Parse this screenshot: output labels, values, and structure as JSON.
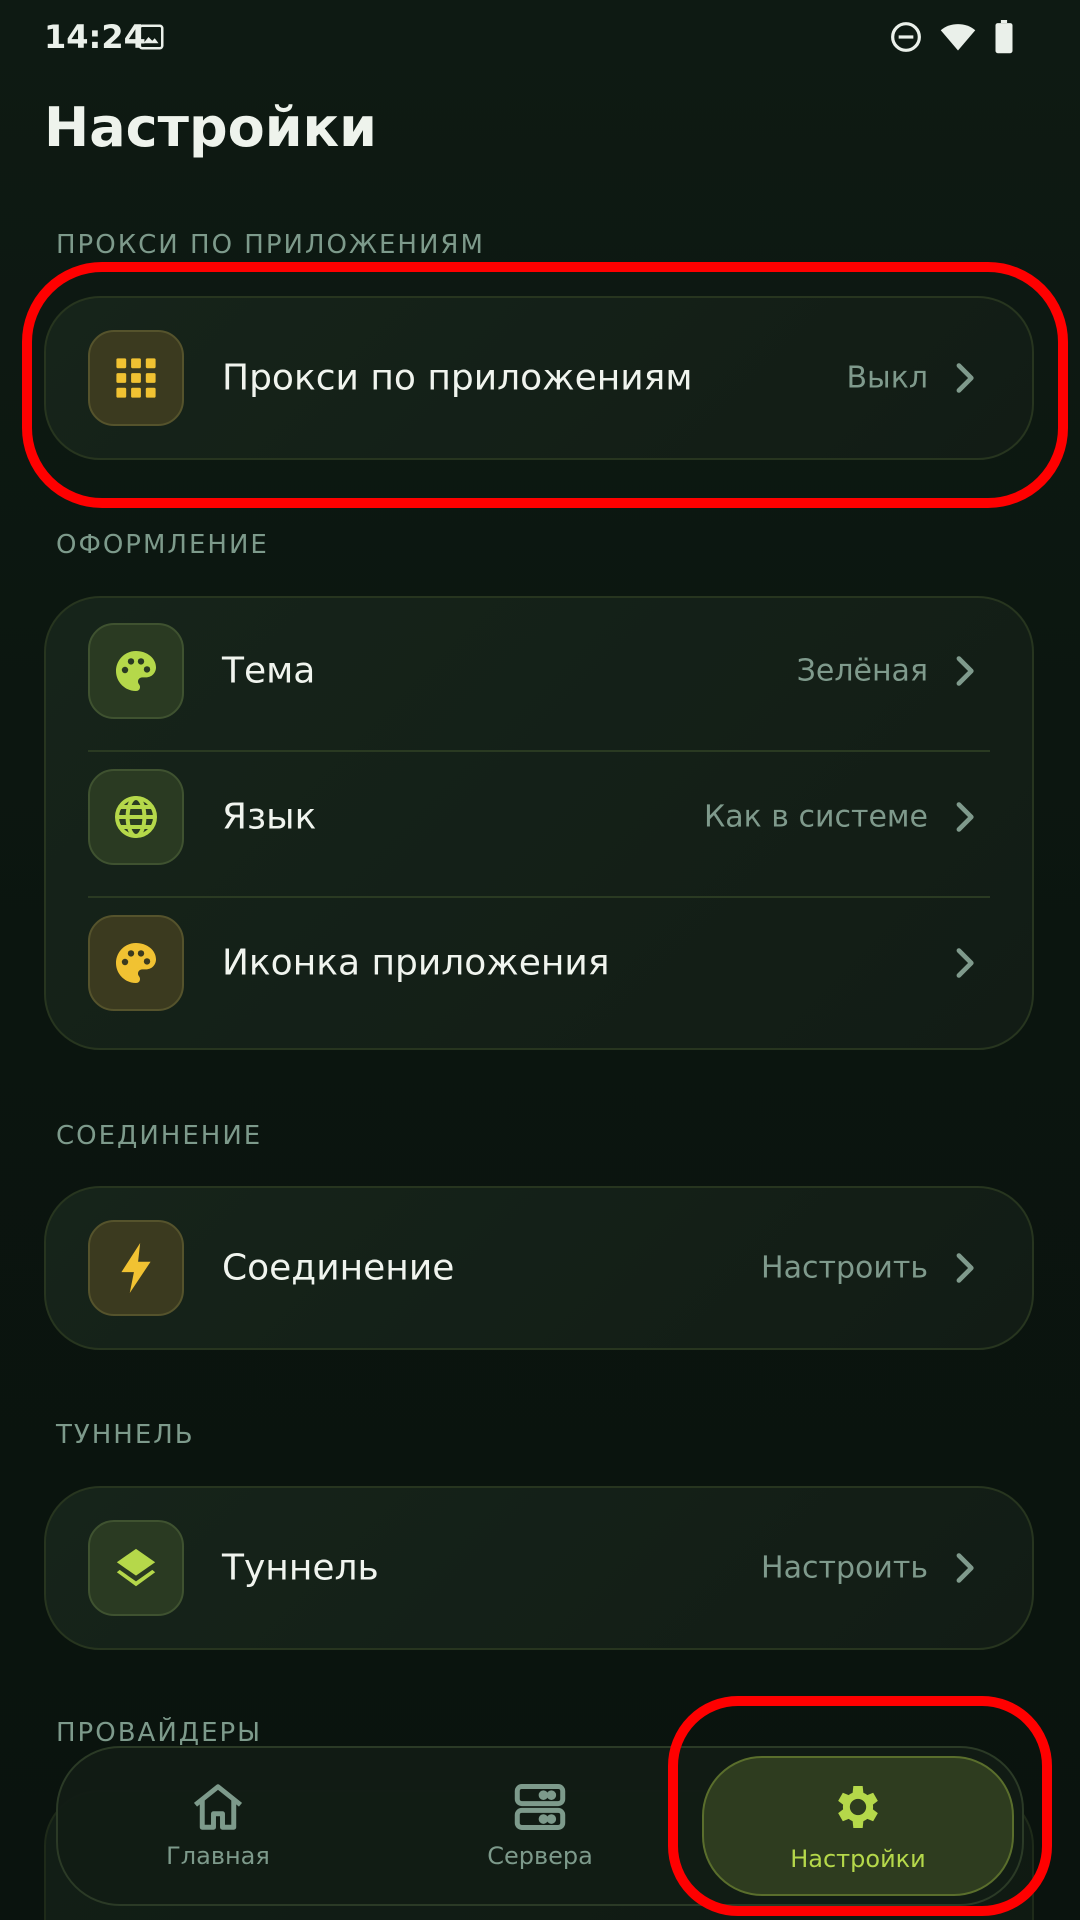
{
  "status_bar": {
    "time": "14:24",
    "icons": [
      "image-icon",
      "dnd-icon",
      "wifi-icon",
      "battery-icon"
    ]
  },
  "page": {
    "title": "Настройки"
  },
  "sections": [
    {
      "label": "ПРОКСИ ПО ПРИЛОЖЕНИЯМ",
      "rows": [
        {
          "icon": "app-grid-icon",
          "label": "Прокси по приложениям",
          "value": "Выкл"
        }
      ]
    },
    {
      "label": "ОФОРМЛЕНИЕ",
      "rows": [
        {
          "icon": "palette-icon",
          "label": "Тема",
          "value": "Зелёная"
        },
        {
          "icon": "globe-icon",
          "label": "Язык",
          "value": "Как в системе"
        },
        {
          "icon": "palette-icon",
          "label": "Иконка приложения",
          "value": ""
        }
      ]
    },
    {
      "label": "СОЕДИНЕНИЕ",
      "rows": [
        {
          "icon": "bolt-icon",
          "label": "Соединение",
          "value": "Настроить"
        }
      ]
    },
    {
      "label": "ТУННЕЛЬ",
      "rows": [
        {
          "icon": "layers-icon",
          "label": "Туннель",
          "value": "Настроить"
        }
      ]
    },
    {
      "label": "ПРОВАЙДЕРЫ",
      "rows": []
    }
  ],
  "bottom_nav": {
    "items": [
      {
        "icon": "home-icon",
        "label": "Главная",
        "active": false
      },
      {
        "icon": "servers-icon",
        "label": "Сервера",
        "active": false
      },
      {
        "icon": "gear-icon",
        "label": "Настройки",
        "active": true
      }
    ]
  },
  "colors": {
    "accent": "#b5d84a",
    "icon_yellow": "#f1c232",
    "icon_green": "#b5d84a",
    "highlight": "#ff0000"
  }
}
